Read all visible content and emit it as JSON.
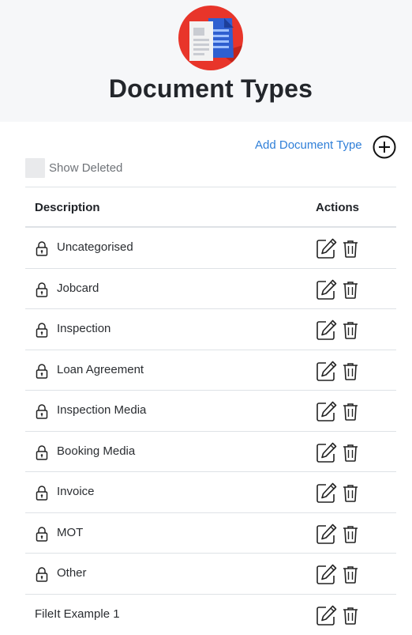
{
  "header": {
    "title": "Document Types",
    "logo_icon": "document-logo-icon",
    "logo_color": "#e8352a"
  },
  "toolbar": {
    "add_label": "Add Document Type",
    "add_icon": "plus-circle-icon",
    "show_deleted_label": "Show Deleted",
    "show_deleted_checked": false
  },
  "table": {
    "columns": [
      "Description",
      "Actions"
    ],
    "rows": [
      {
        "label": "Uncategorised",
        "locked": true
      },
      {
        "label": "Jobcard",
        "locked": true
      },
      {
        "label": "Inspection",
        "locked": true
      },
      {
        "label": "Loan Agreement",
        "locked": true
      },
      {
        "label": "Inspection Media",
        "locked": true
      },
      {
        "label": "Booking Media",
        "locked": true
      },
      {
        "label": "Invoice",
        "locked": true
      },
      {
        "label": "MOT",
        "locked": true
      },
      {
        "label": "Other",
        "locked": true
      },
      {
        "label": "FileIt Example 1",
        "locked": false
      }
    ]
  },
  "colors": {
    "link": "#2f7fd8",
    "header_bg": "#f6f7f9"
  }
}
